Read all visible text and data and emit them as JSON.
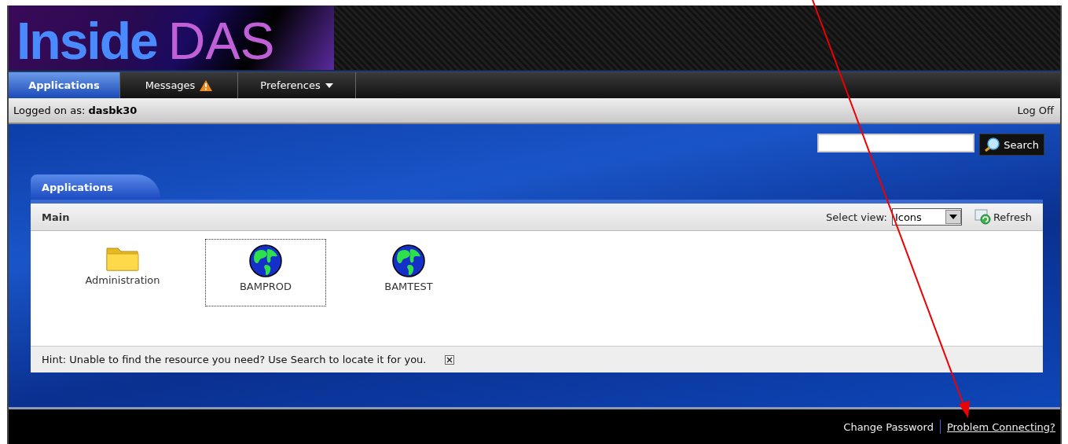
{
  "header": {
    "logo_bold": "Inside",
    "logo_light": "DAS"
  },
  "nav_tabs": [
    {
      "label": "Applications",
      "selected": true,
      "kind": "plain"
    },
    {
      "label": "Messages",
      "selected": false,
      "kind": "alert"
    },
    {
      "label": "Preferences",
      "selected": false,
      "kind": "menu"
    }
  ],
  "user_bar": {
    "prefix": "Logged on as:",
    "user": "dasbk30",
    "log_off": "Log Off"
  },
  "search": {
    "button": "Search"
  },
  "panel": {
    "tab": "Applications",
    "section": "Main",
    "view_label": "Select view:",
    "view_value": "Icons",
    "refresh": "Refresh",
    "items": [
      {
        "label": "Administration",
        "kind": "folder",
        "selected": false
      },
      {
        "label": "BAMPROD",
        "kind": "globe",
        "selected": true
      },
      {
        "label": "BAMTEST",
        "kind": "globe",
        "selected": false
      }
    ],
    "hint": "Hint: Unable to find the resource you need? Use Search to locate it for you."
  },
  "footer": {
    "links": [
      "Change Password",
      "Problem Connecting?"
    ]
  }
}
